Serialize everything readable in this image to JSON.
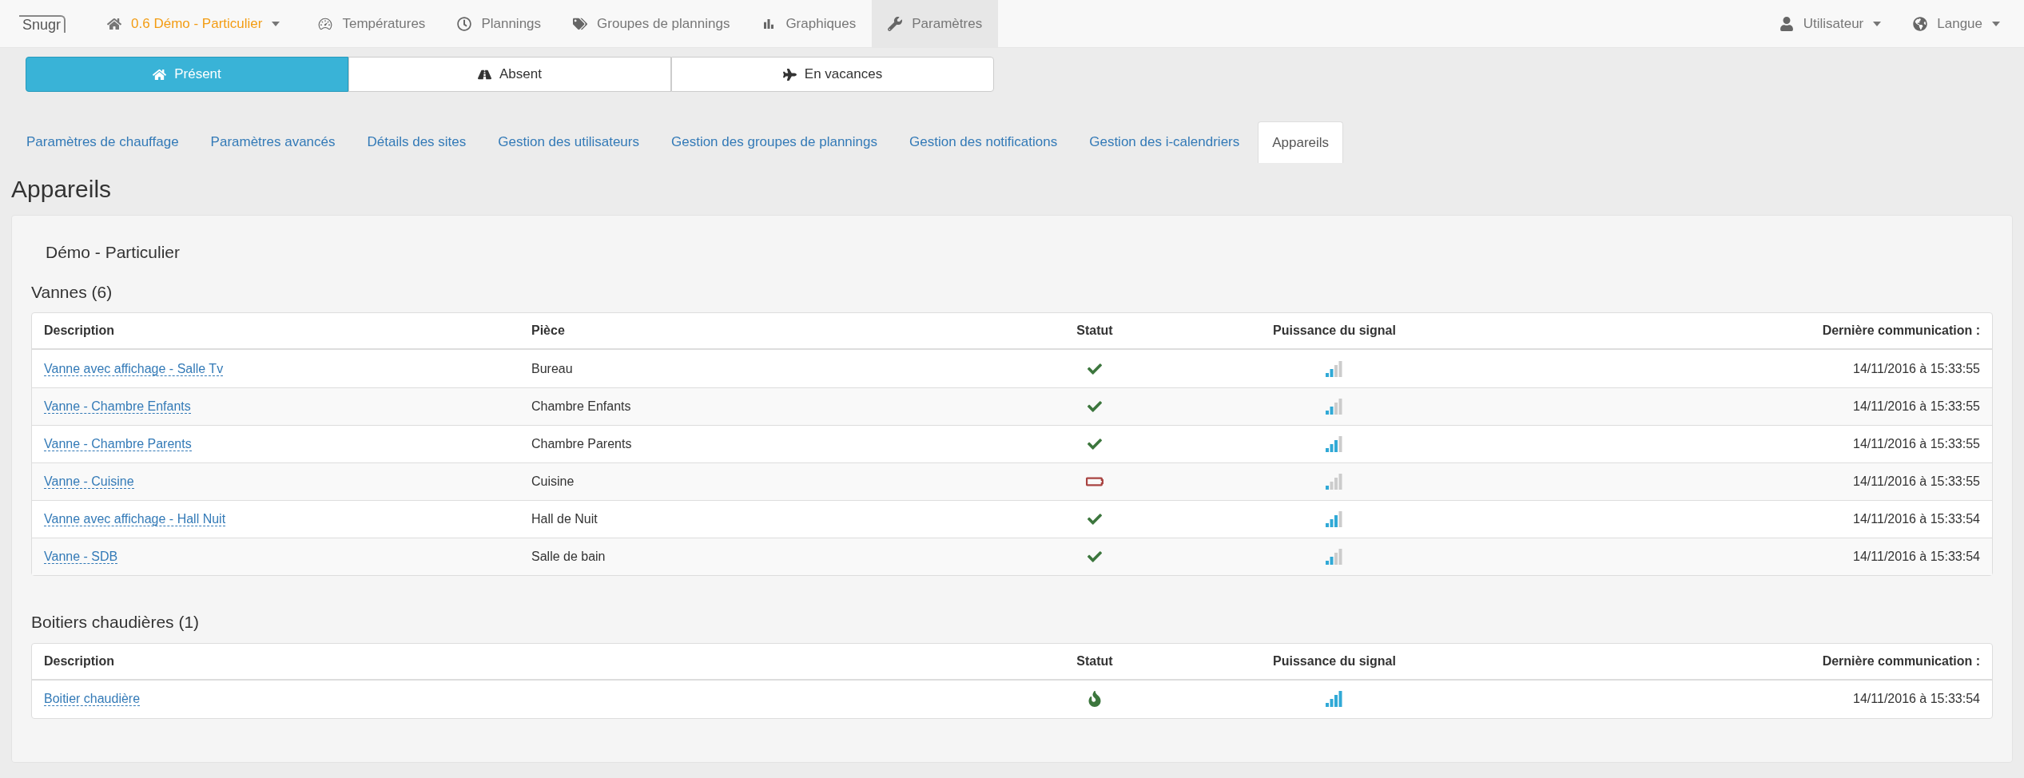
{
  "nav": {
    "logo": "Snugr",
    "site": {
      "label": "0.6 Démo - Particulier"
    },
    "items": [
      {
        "label": "Températures",
        "selected": false
      },
      {
        "label": "Plannings",
        "selected": false
      },
      {
        "label": "Groupes de plannings",
        "selected": false
      },
      {
        "label": "Graphiques",
        "selected": false
      },
      {
        "label": "Paramètres",
        "selected": true
      }
    ],
    "right": [
      {
        "label": "Utilisateur"
      },
      {
        "label": "Langue"
      }
    ]
  },
  "modes": [
    {
      "label": "Présent",
      "selected": true
    },
    {
      "label": "Absent",
      "selected": false
    },
    {
      "label": "En vacances",
      "selected": false
    }
  ],
  "tabs": [
    {
      "label": "Paramètres de chauffage",
      "selected": false
    },
    {
      "label": "Paramètres avancés",
      "selected": false
    },
    {
      "label": "Détails des sites",
      "selected": false
    },
    {
      "label": "Gestion des utilisateurs",
      "selected": false
    },
    {
      "label": "Gestion des groupes de plannings",
      "selected": false
    },
    {
      "label": "Gestion des notifications",
      "selected": false
    },
    {
      "label": "Gestion des i-calendriers",
      "selected": false
    },
    {
      "label": "Appareils",
      "selected": true
    }
  ],
  "heading": "Appareils",
  "site_name": "Démo - Particulier",
  "sections": [
    {
      "title": "Vannes (6)",
      "columns": [
        "Description",
        "Pièce",
        "Statut",
        "Puissance du signal",
        "Dernière communication :"
      ],
      "rows": [
        {
          "description": "Vanne avec affichage - Salle Tv",
          "room": "Bureau",
          "status": {
            "kind": "ok"
          },
          "signal": {
            "kind": "low"
          },
          "time": "14/11/2016 à 15:33:55"
        },
        {
          "description": "Vanne - Chambre Enfants",
          "room": "Chambre Enfants",
          "status": {
            "kind": "ok"
          },
          "signal": {
            "kind": "low"
          },
          "time": "14/11/2016 à 15:33:55"
        },
        {
          "description": "Vanne - Chambre Parents",
          "room": "Chambre Parents",
          "status": {
            "kind": "ok"
          },
          "signal": {
            "kind": "medium"
          },
          "time": "14/11/2016 à 15:33:55"
        },
        {
          "description": "Vanne - Cuisine",
          "room": "Cuisine",
          "status": {
            "kind": "battery"
          },
          "signal": {
            "kind": "weak"
          },
          "time": "14/11/2016 à 15:33:55"
        },
        {
          "description": "Vanne avec affichage - Hall Nuit",
          "room": "Hall de Nuit",
          "status": {
            "kind": "ok"
          },
          "signal": {
            "kind": "medium"
          },
          "time": "14/11/2016 à 15:33:54"
        },
        {
          "description": "Vanne - SDB",
          "room": "Salle de bain",
          "status": {
            "kind": "ok"
          },
          "signal": {
            "kind": "low"
          },
          "time": "14/11/2016 à 15:33:54"
        }
      ]
    },
    {
      "title": "Boitiers chaudières (1)",
      "columns": [
        "Description",
        "Statut",
        "Puissance du signal",
        "Dernière communication :"
      ],
      "rows": [
        {
          "description": "Boitier chaudière",
          "status": {
            "kind": "flame"
          },
          "signal": {
            "kind": "full"
          },
          "time": "14/11/2016 à 15:33:54"
        }
      ]
    }
  ]
}
